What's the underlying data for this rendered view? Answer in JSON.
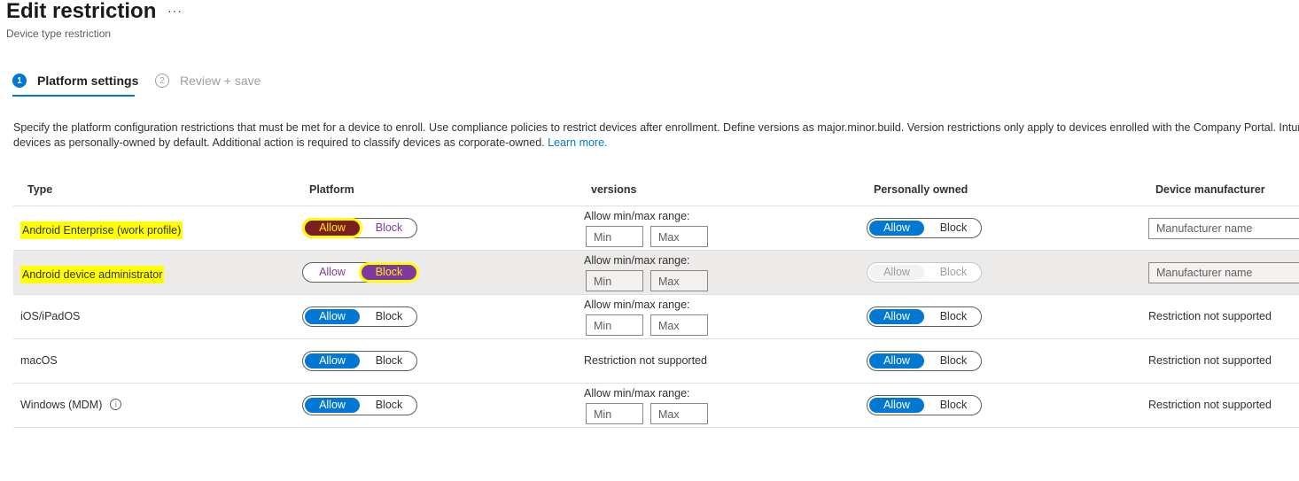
{
  "header": {
    "title": "Edit restriction",
    "more_label": "···",
    "subtitle": "Device type restriction"
  },
  "steps": [
    {
      "number": "1",
      "label": "Platform settings",
      "active": true
    },
    {
      "number": "2",
      "label": "Review + save",
      "active": false
    }
  ],
  "description": {
    "line1": "Specify the platform configuration restrictions that must be met for a device to enroll. Use compliance policies to restrict devices after enrollment. Define versions as major.minor.build. Version restrictions only apply to devices enrolled with the Company Portal. Intune classifies",
    "line2": "devices as personally-owned by default. Additional action is required to classify devices as corporate-owned.",
    "link": "Learn more."
  },
  "table": {
    "headers": {
      "type": "Type",
      "platform": "Platform",
      "versions": "versions",
      "personally_owned": "Personally owned",
      "manufacturer": "Device manufacturer"
    },
    "toggle_labels": {
      "allow": "Allow",
      "block": "Block"
    },
    "range_label": "Allow min/max range:",
    "min_placeholder": "Min",
    "max_placeholder": "Max",
    "manufacturer_placeholder": "Manufacturer name",
    "not_supported": "Restriction not supported",
    "rows": [
      {
        "type": "Android Enterprise (work profile)",
        "platform": "Allow",
        "versions": "range",
        "personally_owned": "Allow",
        "manufacturer": "input"
      },
      {
        "type": "Android device administrator",
        "platform": "Block",
        "versions": "range",
        "personally_owned": "disabled",
        "manufacturer": "input"
      },
      {
        "type": "iOS/iPadOS",
        "platform": "Allow",
        "versions": "range",
        "personally_owned": "Allow",
        "manufacturer": "Restriction not supported"
      },
      {
        "type": "macOS",
        "platform": "Allow",
        "versions": "Restriction not supported",
        "personally_owned": "Allow",
        "manufacturer": "Restriction not supported"
      },
      {
        "type": "Windows (MDM)",
        "platform": "Allow",
        "versions": "range",
        "personally_owned": "Allow",
        "manufacturer": "Restriction not supported"
      }
    ]
  },
  "colors": {
    "accent": "#0078d4",
    "highlight": "#ffff00",
    "platform_toggle": "#7c3aa0"
  }
}
